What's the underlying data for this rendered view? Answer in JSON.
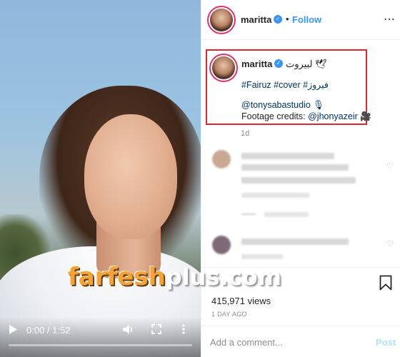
{
  "video": {
    "time": "0:00 / 1:52",
    "progress_fraction": 0,
    "icons": [
      "play-icon",
      "volume-icon",
      "fullscreen-icon",
      "more-vertical-icon"
    ]
  },
  "watermark": {
    "part1": "farfesh",
    "part2": "plus.com"
  },
  "header": {
    "username": "maritta",
    "separator": "•",
    "follow_label": "Follow",
    "more": "⋯"
  },
  "caption": {
    "username": "maritta",
    "arabic_title": "لبيروت 🕊",
    "tags": "#Fairuz #cover #فيروز",
    "credit_handle": "@tonysabastudio 🎙",
    "footage_prefix": "Footage credits: ",
    "footage_handle": "@jhonyazeir 🎥",
    "age": "1d"
  },
  "post": {
    "views": "415,971 views",
    "date": "1 DAY AGO"
  },
  "comment": {
    "placeholder": "Add a comment...",
    "post_label": "Post"
  },
  "colors": {
    "accent": "#3897f0",
    "highlight_box": "#e0262d",
    "muted": "#8e8e8e",
    "post_disabled": "#b2dffc"
  }
}
